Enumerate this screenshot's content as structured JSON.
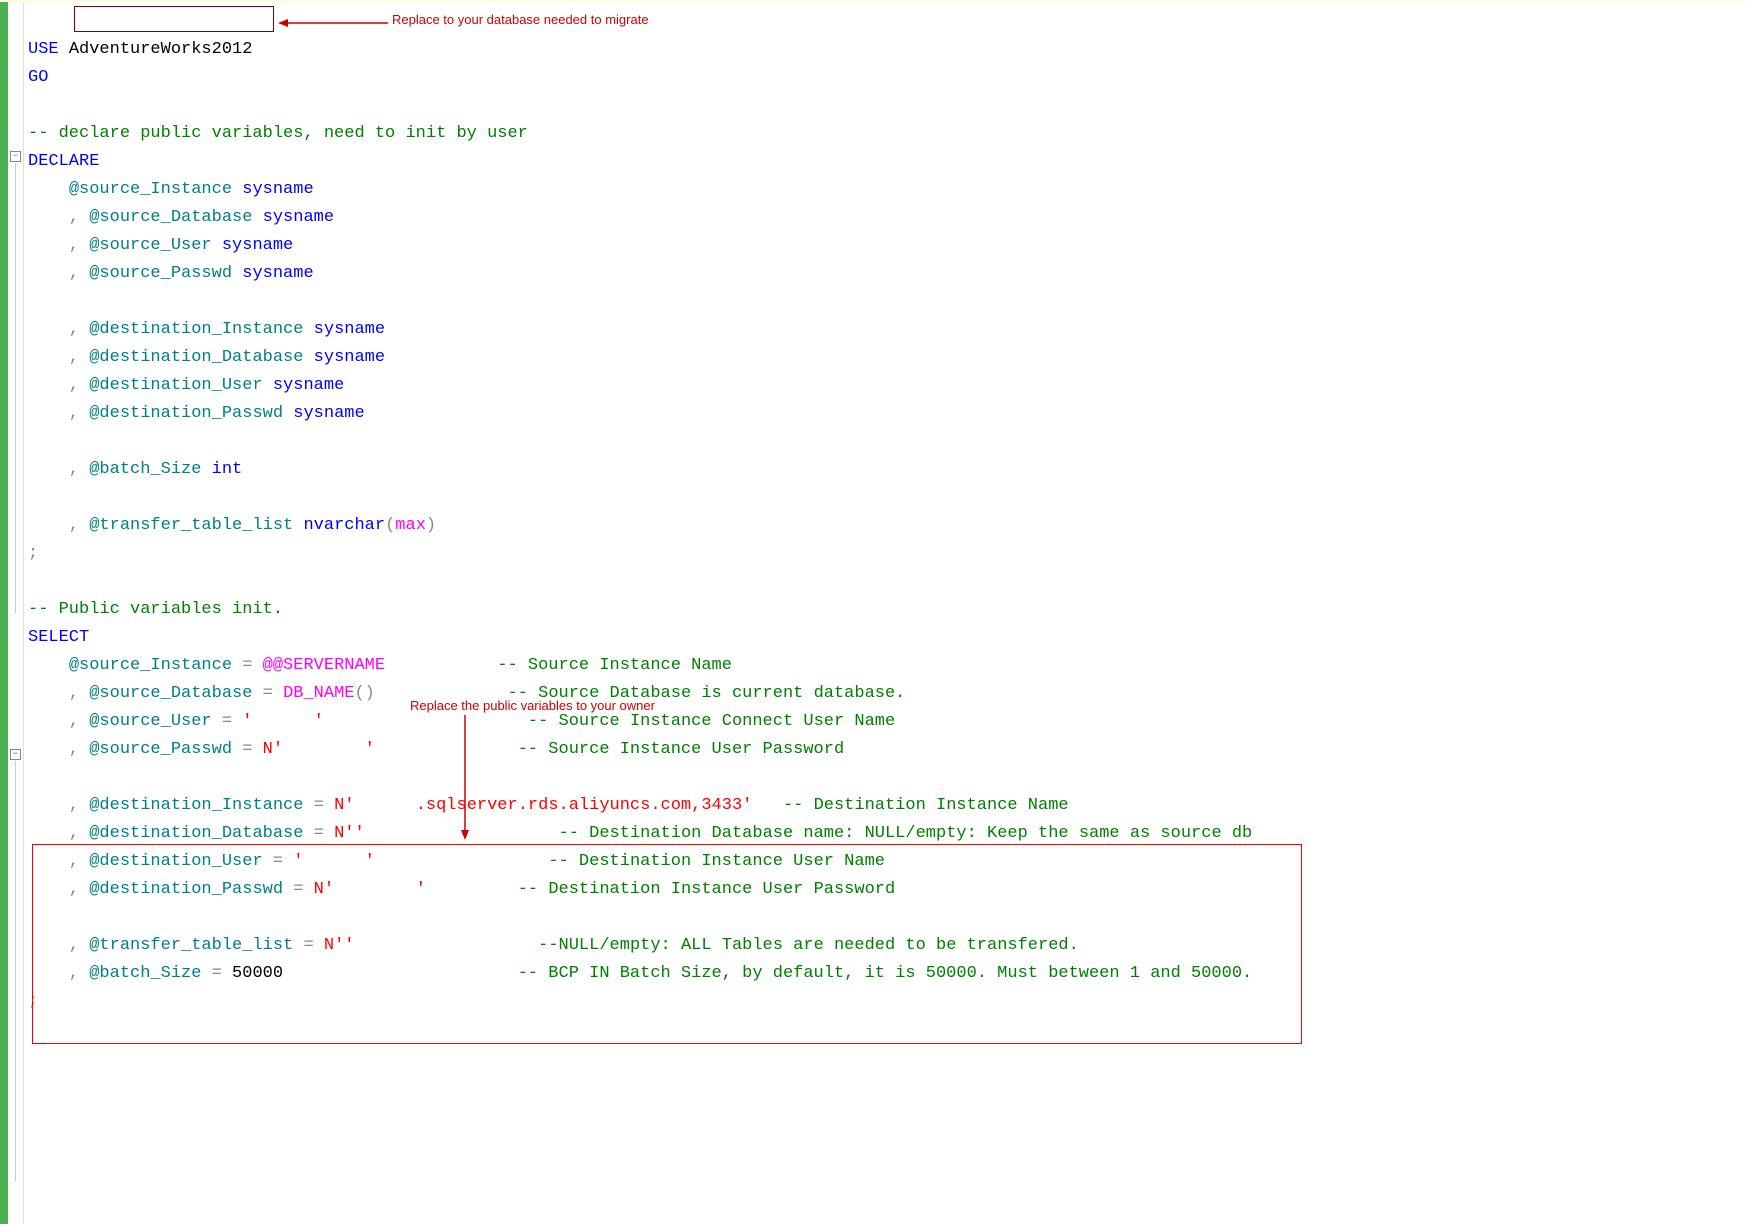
{
  "code": {
    "use": "USE",
    "dbname": "AdventureWorks2012",
    "go": "GO",
    "comment_declare": "-- declare public variables, need to init by user",
    "declare": "DECLARE",
    "src_inst_var": "@source_Instance",
    "src_db_var": "@source_Database",
    "src_user_var": "@source_User",
    "src_pw_var": "@source_Passwd",
    "dst_inst_var": "@destination_Instance",
    "dst_db_var": "@destination_Database",
    "dst_user_var": "@destination_User",
    "dst_pw_var": "@destination_Passwd",
    "batch_var": "@batch_Size",
    "tlist_var": "@transfer_table_list",
    "sysname": "sysname",
    "int": "int",
    "nvarchar": "nvarchar",
    "max": "max",
    "comment_init": "-- Public variables init.",
    "select": "SELECT",
    "servername_fn": "@@SERVERNAME",
    "dbname_fn": "DB_NAME",
    "str_user_redacted": "'      '",
    "str_pw_redacted": "N'        '",
    "str_dst_inst": "N'      .sqlserver.rds.aliyuncs.com,3433'",
    "str_empty": "N''",
    "str_dst_user": "'      '",
    "str_dst_pw": "N'        '",
    "batch_value": "50000",
    "cmt_src_inst": "-- Source Instance Name",
    "cmt_src_db": "-- Source Database is current database.",
    "cmt_src_user": "-- Source Instance Connect User Name",
    "cmt_src_pw": "-- Source Instance User Password",
    "cmt_dst_inst": "-- Destination Instance Name",
    "cmt_dst_db": "-- Destination Database name: NULL/empty: Keep the same as source db",
    "cmt_dst_user": "-- Destination Instance User Name",
    "cmt_dst_pw": "-- Destination Instance User Password",
    "cmt_tlist": "--NULL/empty: ALL Tables are needed to be transfered.",
    "cmt_batch": "-- BCP IN Batch Size, by default, it is 50000. Must between 1 and 50000."
  },
  "annotations": {
    "top": "Replace to your database needed to migrate",
    "middle": "Replace the public variables to your owner"
  }
}
